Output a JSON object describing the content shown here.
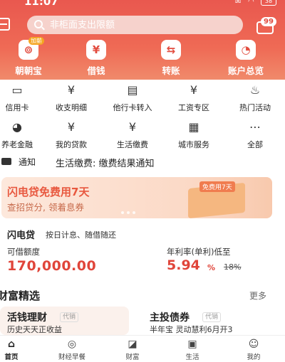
{
  "status_bar": {
    "time": "11:07",
    "battery": "38"
  },
  "header": {
    "search_placeholder": "非柜面支出限额",
    "message_badge": "99",
    "quick_actions": [
      {
        "label": "朝朝宝",
        "icon": "cash-bag-icon",
        "glyph": "⊚",
        "tag": "加薪"
      },
      {
        "label": "借钱",
        "icon": "yen-coin-icon",
        "glyph": "¥",
        "tag": ""
      },
      {
        "label": "转账",
        "icon": "transfer-icon",
        "glyph": "⇆",
        "tag": ""
      },
      {
        "label": "账户总览",
        "icon": "overview-icon",
        "glyph": "◔",
        "tag": ""
      }
    ]
  },
  "grid": {
    "row1": [
      {
        "label": "信用卡",
        "icon": "credit-card-icon",
        "glyph": "▭"
      },
      {
        "label": "收支明细",
        "icon": "statement-icon",
        "glyph": "¥"
      },
      {
        "label": "他行卡转入",
        "icon": "card-in-icon",
        "glyph": "▤"
      },
      {
        "label": "工资专区",
        "icon": "salary-icon",
        "glyph": "¥"
      },
      {
        "label": "热门活动",
        "icon": "flame-icon",
        "glyph": "♨"
      }
    ],
    "row2": [
      {
        "label": "养老金融",
        "icon": "pension-icon",
        "glyph": "◕"
      },
      {
        "label": "我的贷款",
        "icon": "loan-icon",
        "glyph": "¥"
      },
      {
        "label": "生活缴费",
        "icon": "bill-pay-icon",
        "glyph": "¥"
      },
      {
        "label": "城市服务",
        "icon": "city-icon",
        "glyph": "▦"
      },
      {
        "label": "全部",
        "icon": "all-menu-icon",
        "glyph": "⋯"
      }
    ]
  },
  "notice": {
    "tag": "通知",
    "text": "生活缴费: 缴费结果通知"
  },
  "banner": {
    "title": "闪电贷免费用7天",
    "subtitle": "查招贷分, 领着息券",
    "box_tag": "免费用7天"
  },
  "loan": {
    "name": "闪电贷",
    "desc": "按日计息、随借随还",
    "amount_caption": "可借额度",
    "amount": "170,000.00",
    "rate_caption": "年利率(单利)低至",
    "rate": "5.94",
    "rate_unit": "%",
    "old_rate": "18%"
  },
  "wealth": {
    "title": "财富精选",
    "more": "更多",
    "left": {
      "title": "活钱理财",
      "tag": "代销",
      "sub": "历史天天正收益"
    },
    "right": {
      "title": "主投债券",
      "tag": "代销",
      "sub": "半年宝  灵动慧利6月开3"
    }
  },
  "tabbar": [
    {
      "label": "首页",
      "icon": "home-icon",
      "glyph": "⌂",
      "active": true
    },
    {
      "label": "财经早餐",
      "icon": "news-icon",
      "glyph": "◎",
      "active": false
    },
    {
      "label": "财富",
      "icon": "wealth-icon",
      "glyph": "◪",
      "active": false
    },
    {
      "label": "生活",
      "icon": "life-icon",
      "glyph": "▣",
      "active": false
    },
    {
      "label": "我的",
      "icon": "profile-icon",
      "glyph": "☺",
      "active": false
    }
  ]
}
